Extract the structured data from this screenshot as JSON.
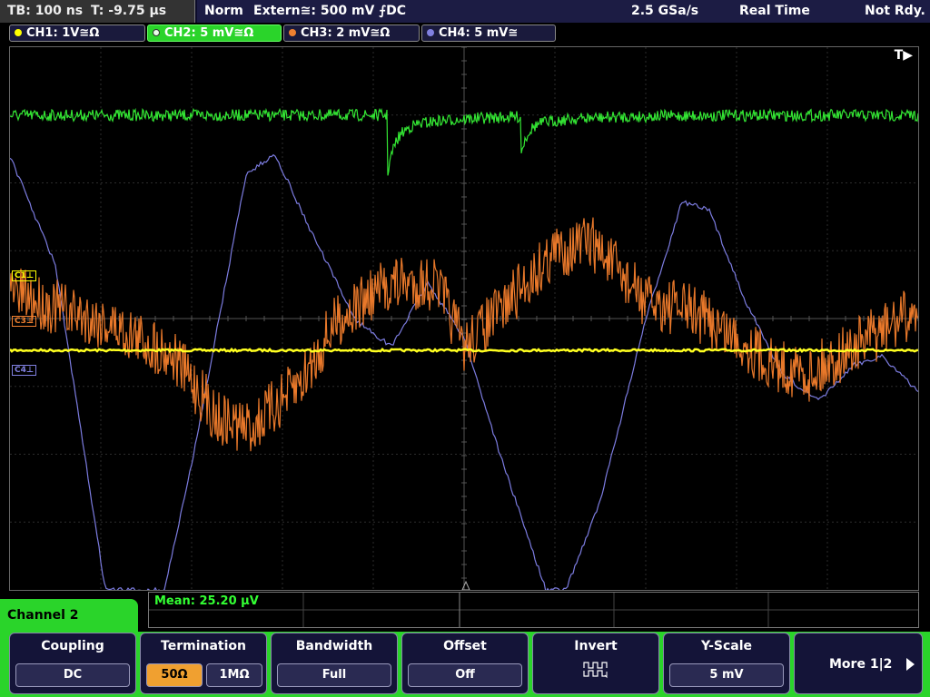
{
  "status": {
    "timebase": "TB: 100 ns",
    "trigger_time": "T: -9.75 µs",
    "mode": "Norm",
    "trigger_source": "Extern≅: 500 mV ⨍DC",
    "sample_rate": "2.5 GSa/s",
    "acq_mode": "Real Time",
    "state": "Not Rdy."
  },
  "channels": [
    {
      "label": "CH1: 1V≅Ω",
      "color": "#ffff00"
    },
    {
      "label": "CH2: 5 mV≅Ω",
      "color": "#33ee33"
    },
    {
      "label": "CH3: 2 mV≅Ω",
      "color": "#f08030"
    },
    {
      "label": "CH4: 5 mV≅",
      "color": "#8080e0"
    }
  ],
  "screen": {
    "trigger_marker": "T▶",
    "markers": {
      "c1": "C1⊥",
      "c3": "C3⊥",
      "c4": "C4⊥"
    }
  },
  "measurement": {
    "text": "Mean: 25.20 µV"
  },
  "menu": {
    "channel_title": "Channel 2",
    "coupling": {
      "label": "Coupling",
      "value": "DC"
    },
    "termination": {
      "label": "Termination",
      "opt1": "50Ω",
      "opt2": "1MΩ"
    },
    "bandwidth": {
      "label": "Bandwidth",
      "value": "Full"
    },
    "offset": {
      "label": "Offset",
      "value": "Off"
    },
    "invert": {
      "label": "Invert",
      "icon": "invert-waveform-icon"
    },
    "yscale": {
      "label": "Y-Scale",
      "value": "5 mV"
    },
    "more": {
      "label": "More 1|2"
    }
  }
}
